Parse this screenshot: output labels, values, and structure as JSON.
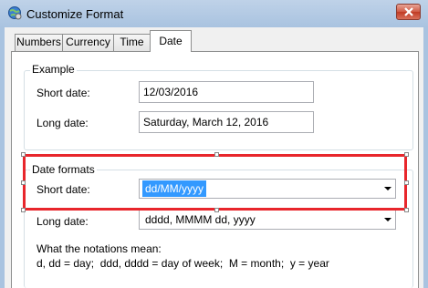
{
  "window": {
    "title": "Customize Format",
    "icon": "globe-settings-icon",
    "close_icon": "close-icon"
  },
  "tabs": [
    {
      "label": "Numbers",
      "active": false
    },
    {
      "label": "Currency",
      "active": false
    },
    {
      "label": "Time",
      "active": false
    },
    {
      "label": "Date",
      "active": true
    }
  ],
  "example": {
    "group_label": "Example",
    "short_date_label": "Short date:",
    "short_date_value": "12/03/2016",
    "long_date_label": "Long date:",
    "long_date_value": "Saturday, March 12, 2016"
  },
  "date_formats": {
    "group_label": "Date formats",
    "short_date_label": "Short date:",
    "short_date_value": "dd/MM/yyyy",
    "long_date_label": "Long date:",
    "long_date_value": "dddd, MMMM dd, yyyy"
  },
  "notations": {
    "line1": "What the notations mean:",
    "line2": "d, dd = day;  ddd, dddd = day of week;  M = month;  y = year"
  },
  "colors": {
    "highlight": "#e8262c",
    "selection": "#3399ff"
  }
}
